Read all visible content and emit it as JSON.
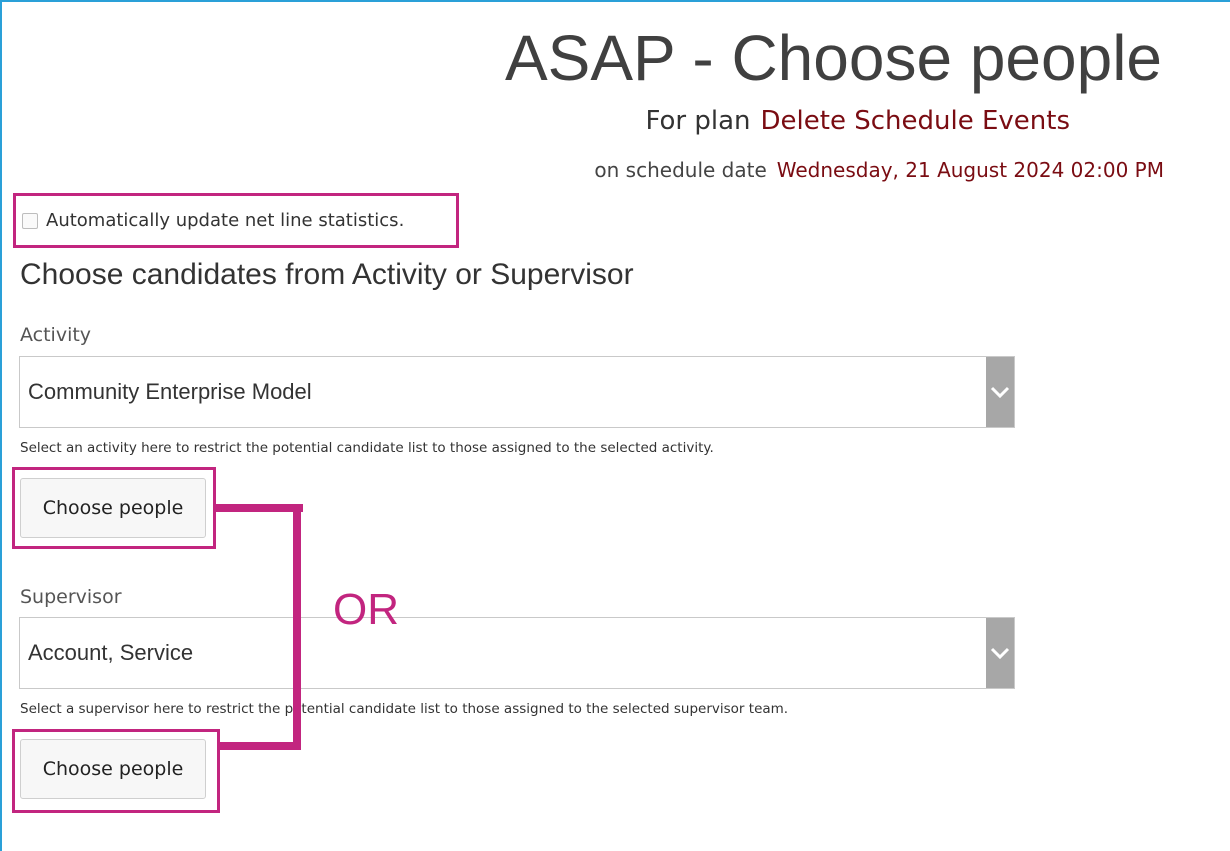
{
  "page": {
    "title": "ASAP - Choose people",
    "plan_label": "For plan",
    "plan_name": "Delete Schedule Events",
    "date_label": "on schedule date",
    "schedule_date": "Wednesday, 21 August 2024 02:00 PM"
  },
  "options": {
    "auto_update_label": "Automatically update net line statistics.",
    "auto_update_checked": false
  },
  "section": {
    "title": "Choose candidates from Activity or Supervisor"
  },
  "activity": {
    "label": "Activity",
    "selected": "Community Enterprise Model",
    "help": "Select an activity here to restrict the potential candidate list to those assigned to the selected activity.",
    "button_label": "Choose people"
  },
  "supervisor": {
    "label": "Supervisor",
    "selected": "Account, Service",
    "help": "Select a supervisor here to restrict the potential candidate list to those assigned to the selected supervisor team.",
    "button_label": "Choose people"
  },
  "annotation": {
    "or_label": "OR",
    "color": "#c2257f"
  },
  "colors": {
    "accent_text": "#7a0c12",
    "frame": "#2aa0d8",
    "dropdown_arrow_bg": "#a7a7a7"
  },
  "icons": {
    "dropdown": "chevron-down-icon"
  }
}
